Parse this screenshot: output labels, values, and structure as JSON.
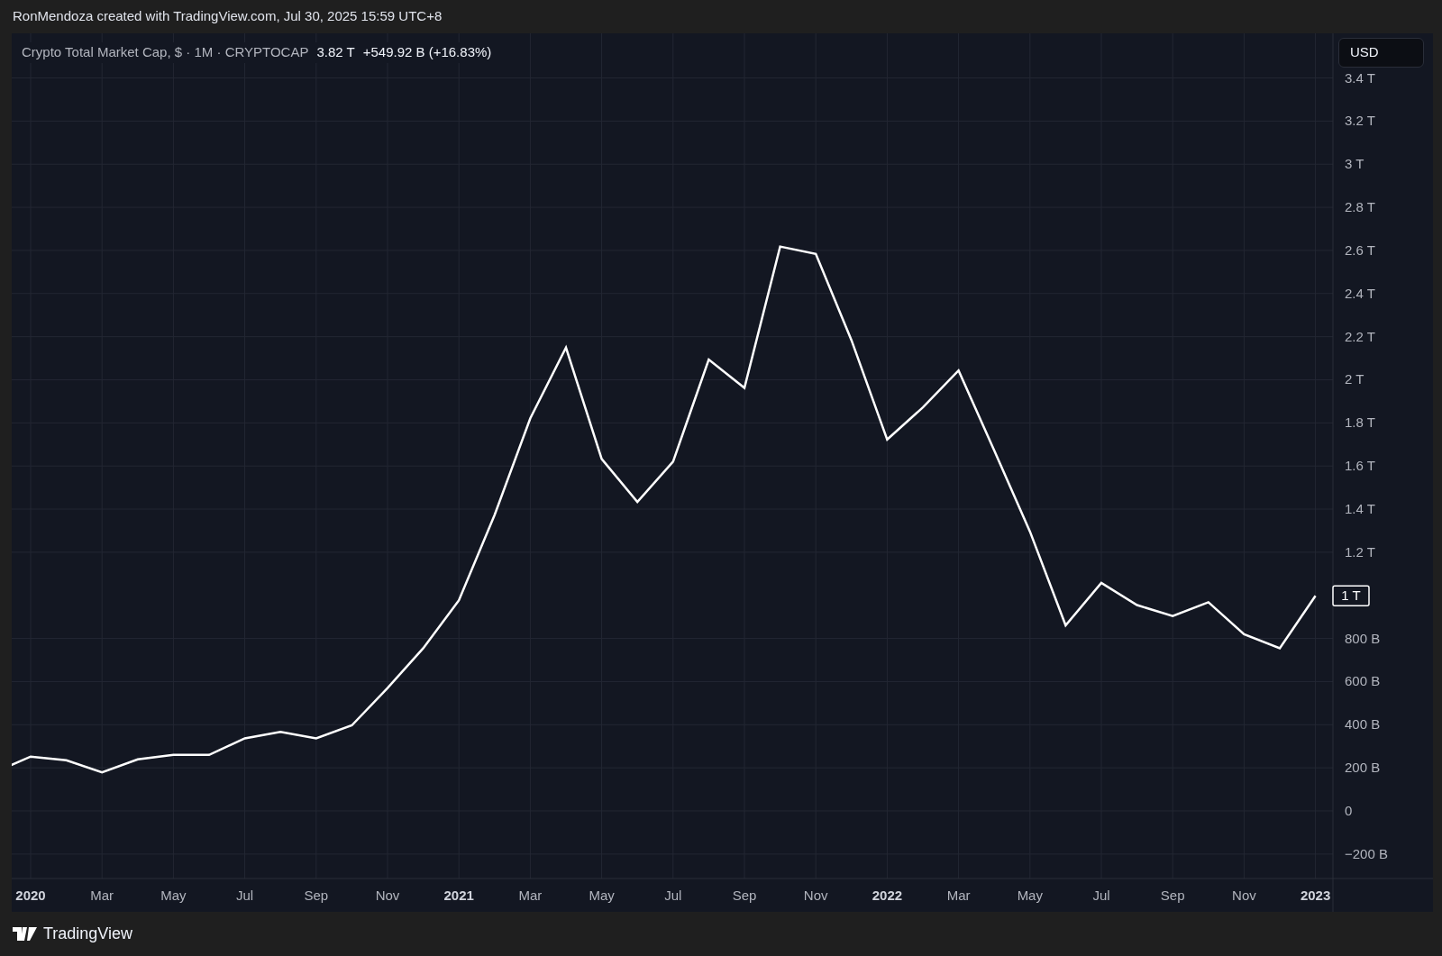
{
  "snapshot_caption": "RonMendoza created with TradingView.com, Jul 30, 2025 15:59 UTC+8",
  "legend": {
    "symbol": "Crypto Total Market Cap, $ · 1M · CRYPTOCAP",
    "price": "3.82 T",
    "change": "+549.92 B (+16.83%)"
  },
  "currency_button": "USD",
  "last_value_label": "1 T",
  "chart_data": {
    "type": "line",
    "categories": [
      null,
      "2020",
      null,
      "Mar",
      null,
      "May",
      null,
      "Jul",
      null,
      "Sep",
      null,
      "Nov",
      null,
      "2021",
      null,
      "Mar",
      null,
      "May",
      null,
      "Jul",
      null,
      "Sep",
      null,
      "Nov",
      null,
      "2022",
      null,
      "Mar",
      null,
      "May",
      null,
      "Jul",
      null,
      "Sep",
      null,
      "Nov",
      null,
      "2023"
    ],
    "series": [
      {
        "color": "#ffffff",
        "values": [
          180000000000.0,
          252000000000.0,
          235000000000.0,
          179000000000.0,
          239000000000.0,
          260000000000.0,
          260000000000.0,
          337000000000.0,
          367000000000.0,
          337000000000.0,
          397000000000.0,
          570000000000.0,
          755000000000.0,
          977000000000.0,
          1373000000000.0,
          1821000000000.0,
          2149000000000.0,
          1633000000000.0,
          1433000000000.0,
          1620000000000.0,
          2094000000000.0,
          1962000000000.0,
          2618000000000.0,
          2584000000000.0,
          2183000000000.0,
          1723000000000.0,
          1872000000000.0,
          2043000000000.0,
          1672000000000.0,
          1296000000000.0,
          861000000000.0,
          1058000000000.0,
          955000000000.0,
          904000000000.0,
          968000000000.0,
          819000000000.0,
          755000000000.0,
          998000000000.0
        ]
      }
    ],
    "ylim": [
      -313500000000.0,
      3607000000000.0
    ],
    "grid": true,
    "yticks": [
      {
        "value": 3400000000000.0,
        "label": "3.4 T"
      },
      {
        "value": 3200000000000.0,
        "label": "3.2 T"
      },
      {
        "value": 3000000000000.0,
        "label": "3 T"
      },
      {
        "value": 2800000000000.0,
        "label": "2.8 T"
      },
      {
        "value": 2600000000000.0,
        "label": "2.6 T"
      },
      {
        "value": 2400000000000.0,
        "label": "2.4 T"
      },
      {
        "value": 2200000000000.0,
        "label": "2.2 T"
      },
      {
        "value": 2000000000000.0,
        "label": "2 T"
      },
      {
        "value": 1800000000000.0,
        "label": "1.8 T"
      },
      {
        "value": 1600000000000.0,
        "label": "1.6 T"
      },
      {
        "value": 1400000000000.0,
        "label": "1.4 T"
      },
      {
        "value": 1200000000000.0,
        "label": "1.2 T"
      },
      {
        "value": 800000000000.0,
        "label": "800 B"
      },
      {
        "value": 600000000000.0,
        "label": "600 B"
      },
      {
        "value": 400000000000.0,
        "label": "400 B"
      },
      {
        "value": 200000000000.0,
        "label": "200 B"
      },
      {
        "value": 0,
        "label": "0"
      },
      {
        "value": -200000000000.0,
        "label": "−200 B"
      }
    ]
  },
  "footer_logo": "TradingView"
}
